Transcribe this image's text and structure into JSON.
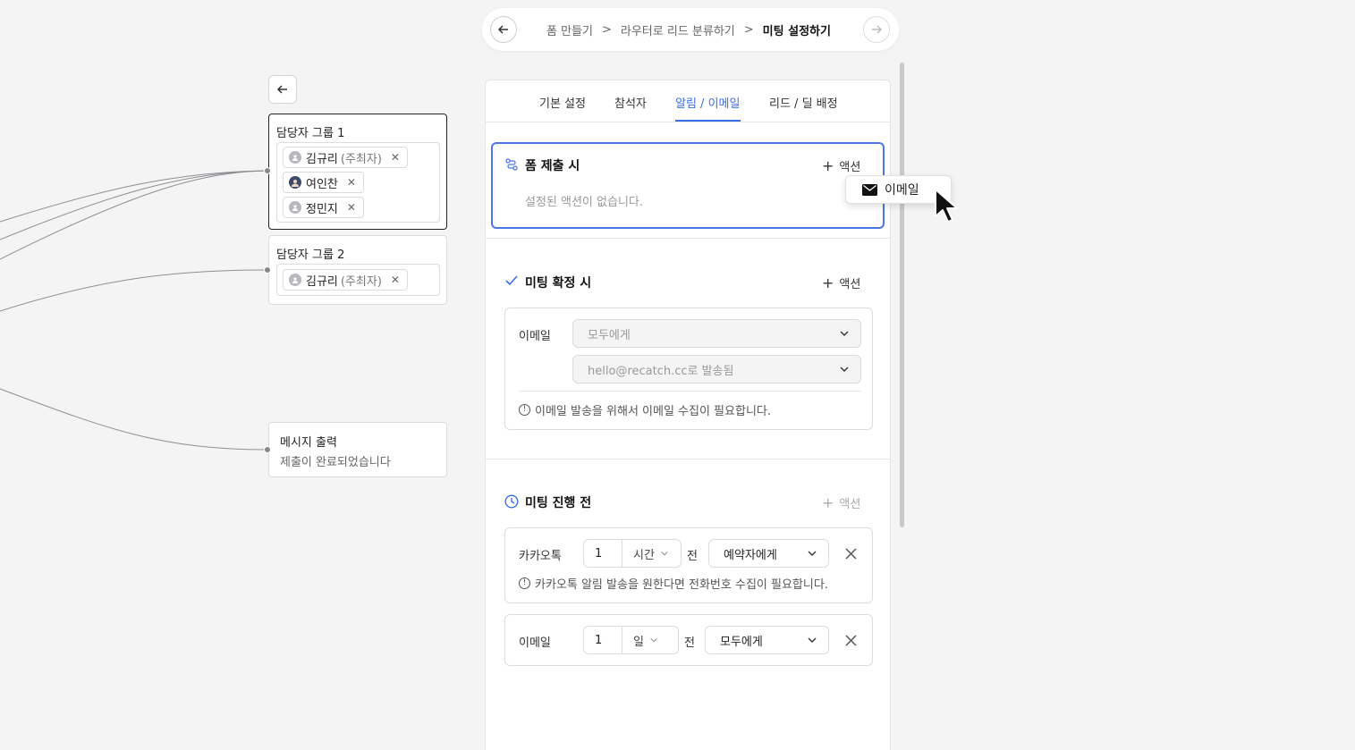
{
  "breadcrumb": {
    "items": [
      "폼 만들기",
      "라우터로 리드 분류하기",
      "미팅 설정하기"
    ],
    "separator": ">"
  },
  "nodes": {
    "group1": {
      "title": "담당자 그룹 1",
      "members": [
        {
          "name": "김규리",
          "role": "(주최자)"
        },
        {
          "name": "여인찬",
          "role": ""
        },
        {
          "name": "정민지",
          "role": ""
        }
      ]
    },
    "group2": {
      "title": "담당자 그룹 2",
      "members": [
        {
          "name": "김규리",
          "role": "(주최자)"
        }
      ]
    },
    "message": {
      "title": "메시지 출력",
      "text": "제출이 완료되었습니다"
    }
  },
  "tabs": [
    "기본 설정",
    "참석자",
    "알림 / 이메일",
    "리드 / 딜 배정"
  ],
  "active_tab": "알림 / 이메일",
  "sections": {
    "form_submit": {
      "title": "폼 제출 시",
      "add": "액션",
      "empty": "설정된 액션이 없습니다."
    },
    "meeting_confirm": {
      "title": "미팅 확정 시",
      "add": "액션",
      "email_label": "이메일",
      "to_placeholder": "모두에게",
      "from_placeholder": "hello@recatch.cc로 발송됨",
      "info": "이메일 발송을 위해서 이메일 수집이 필요합니다."
    },
    "before_meeting": {
      "title": "미팅 진행 전",
      "add": "액션",
      "kakao": {
        "label": "카카오톡",
        "amount": "1",
        "unit": "시간",
        "suffix": "전",
        "target": "예약자에게",
        "info": "카카오톡 알림 발송을 원한다면 전화번호 수집이 필요합니다."
      },
      "email": {
        "label": "이메일",
        "amount": "1",
        "unit": "일",
        "suffix": "전",
        "target": "모두에게"
      }
    }
  },
  "popover": {
    "item": "이메일"
  },
  "colors": {
    "accent": "#3a6ee8",
    "bg": "#f4f4f5"
  }
}
